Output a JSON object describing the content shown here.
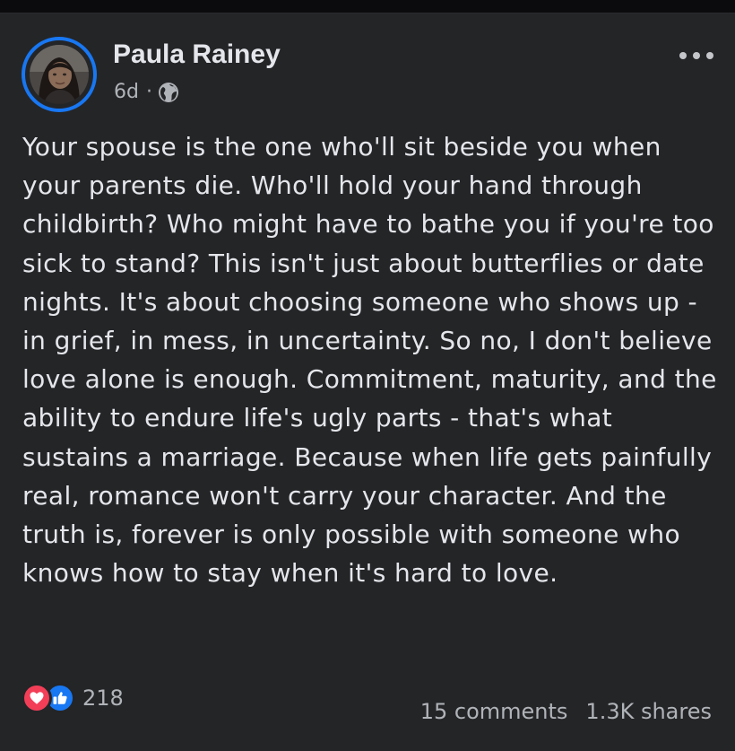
{
  "post": {
    "author": "Paula Rainey",
    "time": "6d",
    "separator": "·",
    "privacy_icon": "globe-icon",
    "menu_icon": "more-options-icon",
    "text": "Your spouse is the one who'll sit beside you when your parents die. Who'll hold your hand through childbirth? Who might have to bathe you if you're too sick to stand? This isn't just about butterflies or date nights. It's about choosing someone who shows up - in grief, in mess, in uncertainty. So no, I don't believe love alone is enough. Commitment, maturity, and the ability to endure life's ugly parts - that's what sustains a marriage. Because when life gets painfully real, romance won't carry your character. And the truth is, forever is only possible with someone who knows how to stay when it's hard to love."
  },
  "footer": {
    "reaction_icons": [
      "love-icon",
      "like-icon"
    ],
    "reaction_count": "218",
    "comments": "15 comments",
    "shares": "1.3K shares"
  },
  "colors": {
    "background": "#242527",
    "text": "#e4e6eb",
    "secondary_text": "#b0b3b8",
    "accent": "#1877f2",
    "love": "#f33e58"
  }
}
